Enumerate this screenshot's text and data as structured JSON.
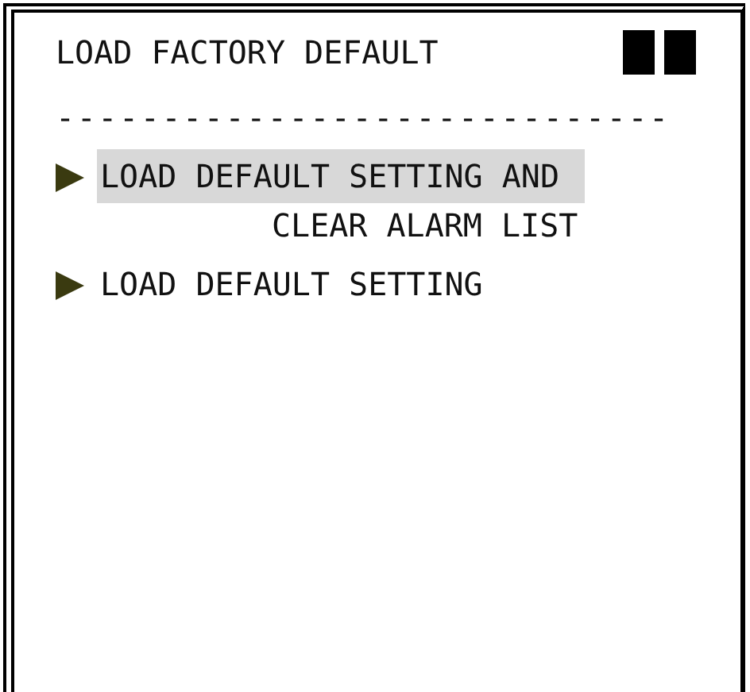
{
  "screen": {
    "title": "LOAD FACTORY DEFAULT",
    "separator": "-----------------------------",
    "items": [
      {
        "lines": [
          "LOAD DEFAULT SETTING AND",
          "CLEAR ALARM LIST"
        ],
        "selected": true
      },
      {
        "lines": [
          "LOAD DEFAULT SETTING"
        ],
        "selected": false
      }
    ]
  }
}
